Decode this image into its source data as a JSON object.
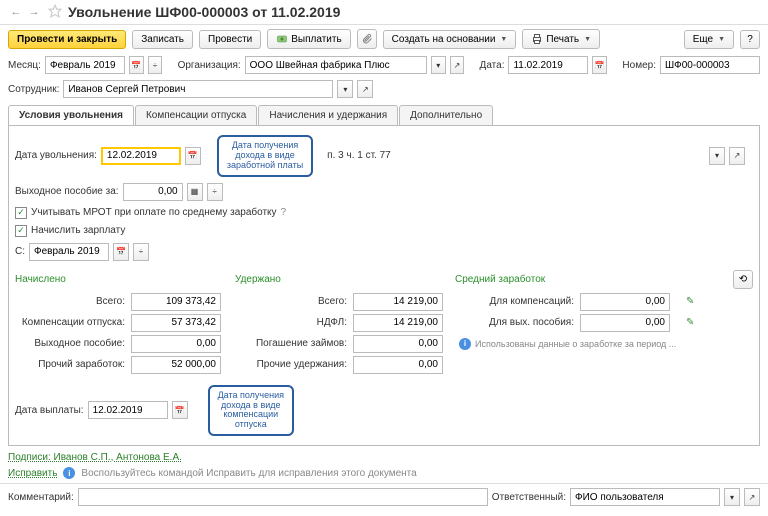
{
  "title": "Увольнение ШФ00-000003 от 11.02.2019",
  "toolbar": {
    "save_close": "Провести и закрыть",
    "save": "Записать",
    "post": "Провести",
    "pay": "Выплатить",
    "create_basis": "Создать на основании",
    "print": "Печать",
    "more": "Еще",
    "help": "?"
  },
  "head": {
    "month_label": "Месяц:",
    "month": "Февраль 2019",
    "org_label": "Организация:",
    "org": "ООО Швейная фабрика Плюс",
    "date_label": "Дата:",
    "date": "11.02.2019",
    "num_label": "Номер:",
    "num": "ШФ00-000003",
    "emp_label": "Сотрудник:",
    "emp": "Иванов Сергей Петрович"
  },
  "tabs": {
    "t1": "Условия увольнения",
    "t2": "Компенсации отпуска",
    "t3": "Начисления и удержания",
    "t4": "Дополнительно"
  },
  "cond": {
    "dismiss_date_label": "Дата увольнения:",
    "dismiss_date": "12.02.2019",
    "basis_suffix": "п. 3 ч. 1 ст. 77",
    "tooltip1_l1": "Дата получения",
    "tooltip1_l2": "дохода в виде",
    "tooltip1_l3": "заработной платы",
    "severance_label": "Выходное пособие за:",
    "severance_val": "0,00",
    "mrot": "Учитывать МРОТ при оплате по среднему заработку",
    "accrue": "Начислить зарплату",
    "from_label": "С:",
    "from": "Февраль 2019"
  },
  "cols": {
    "accrued": "Начислено",
    "withheld": "Удержано",
    "avg": "Средний заработок"
  },
  "grid": {
    "total": "Всего:",
    "total_v": "109 373,42",
    "total2": "Всего:",
    "total2_v": "14 219,00",
    "comp_label": "Для компенсаций:",
    "comp_v": "0,00",
    "comp_vac": "Компенсации отпуска:",
    "comp_vac_v": "57 373,42",
    "ndfl": "НДФЛ:",
    "ndfl_v": "14 219,00",
    "sev_label": "Для вых. пособия:",
    "sev_v": "0,00",
    "severance": "Выходное пособие:",
    "severance_v": "0,00",
    "loans": "Погашение займов:",
    "loans_v": "0,00",
    "used_info": "Использованы данные о заработке за период ...",
    "other": "Прочий заработок:",
    "other_v": "52 000,00",
    "other_w": "Прочие удержания:",
    "other_w_v": "0,00"
  },
  "payout": {
    "label": "Дата выплаты:",
    "date": "12.02.2019",
    "tooltip_l1": "Дата получения",
    "tooltip_l2": "дохода в виде",
    "tooltip_l3": "компенсации",
    "tooltip_l4": "отпуска"
  },
  "footer": {
    "signatures": "Подписи: Иванов С.П., Антонова Е.А.",
    "fix": "Исправить",
    "fix_hint": "Воспользуйтесь командой Исправить для исправления этого документа",
    "comment_label": "Комментарий:",
    "resp_label": "Ответственный:",
    "resp": "ФИО пользователя"
  }
}
